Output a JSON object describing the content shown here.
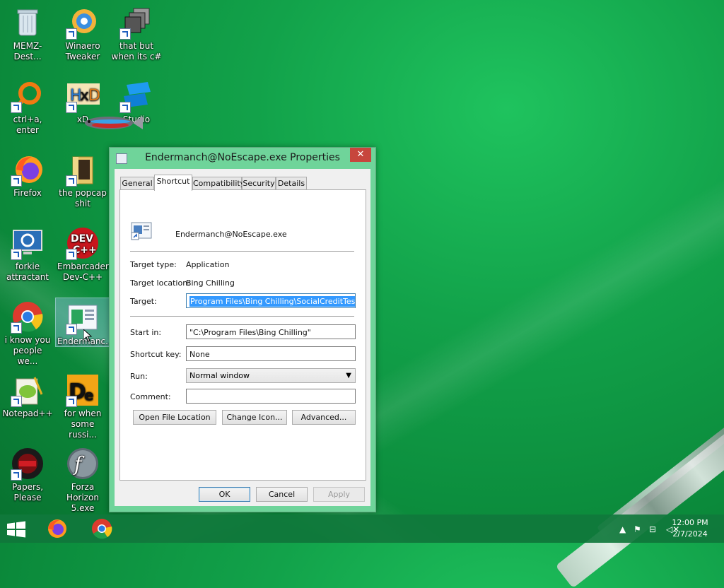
{
  "desktop": {
    "icons": [
      {
        "label": "MEMZ-Dest...",
        "icon": "recycle-bin-icon"
      },
      {
        "label": "Winaero Tweaker",
        "icon": "winaero-icon"
      },
      {
        "label": "that but when its c#",
        "icon": "stack-icon"
      },
      {
        "label": "ctrl+a, enter",
        "icon": "magnifier-ring-icon"
      },
      {
        "label": "xD",
        "icon": "hxd-icon"
      },
      {
        "label": "Studio",
        "icon": "studio-icon"
      },
      {
        "label": "Firefox",
        "icon": "firefox-icon"
      },
      {
        "label": "the popcap shit",
        "icon": "folder-icon"
      },
      {
        "label": "forkie attractant",
        "icon": "settings-monitor-icon"
      },
      {
        "label": "Embarcadero Dev-C++",
        "icon": "devcpp-icon"
      },
      {
        "label": "i know you people we...",
        "icon": "chrome-icon"
      },
      {
        "label": "Endermanc...",
        "icon": "window-app-icon"
      },
      {
        "label": "Notepad++",
        "icon": "notepadpp-icon"
      },
      {
        "label": "for when some russi...",
        "icon": "de-icon"
      },
      {
        "label": "Papers, Please",
        "icon": "papers-please-icon"
      },
      {
        "label": "Forza Horizon 5.exe",
        "icon": "flash-icon"
      }
    ]
  },
  "dialog": {
    "title": "Endermanch@NoEscape.exe Properties",
    "close": "✕",
    "tabs": [
      "General",
      "Shortcut",
      "Compatibility",
      "Security",
      "Details"
    ],
    "active_tab": "Shortcut",
    "shortcut_name": "Endermanch@NoEscape.exe",
    "target_type_label": "Target type:",
    "target_type_value": "Application",
    "target_location_label": "Target location:",
    "target_location_value": "Bing Chilling",
    "target_label": "Target:",
    "target_value": "Program Files\\Bing Chilling\\SocialCreditTest.exe\"",
    "start_in_label": "Start in:",
    "start_in_value": "\"C:\\Program Files\\Bing Chilling\"",
    "shortcut_key_label": "Shortcut key:",
    "shortcut_key_value": "None",
    "run_label": "Run:",
    "run_value": "Normal window",
    "comment_label": "Comment:",
    "comment_value": "",
    "buttons": {
      "open_location": "Open File Location",
      "change_icon": "Change Icon...",
      "advanced": "Advanced...",
      "ok": "OK",
      "cancel": "Cancel",
      "apply": "Apply"
    }
  },
  "taskbar": {
    "time": "12:00 PM",
    "date": "2/7/2024"
  }
}
